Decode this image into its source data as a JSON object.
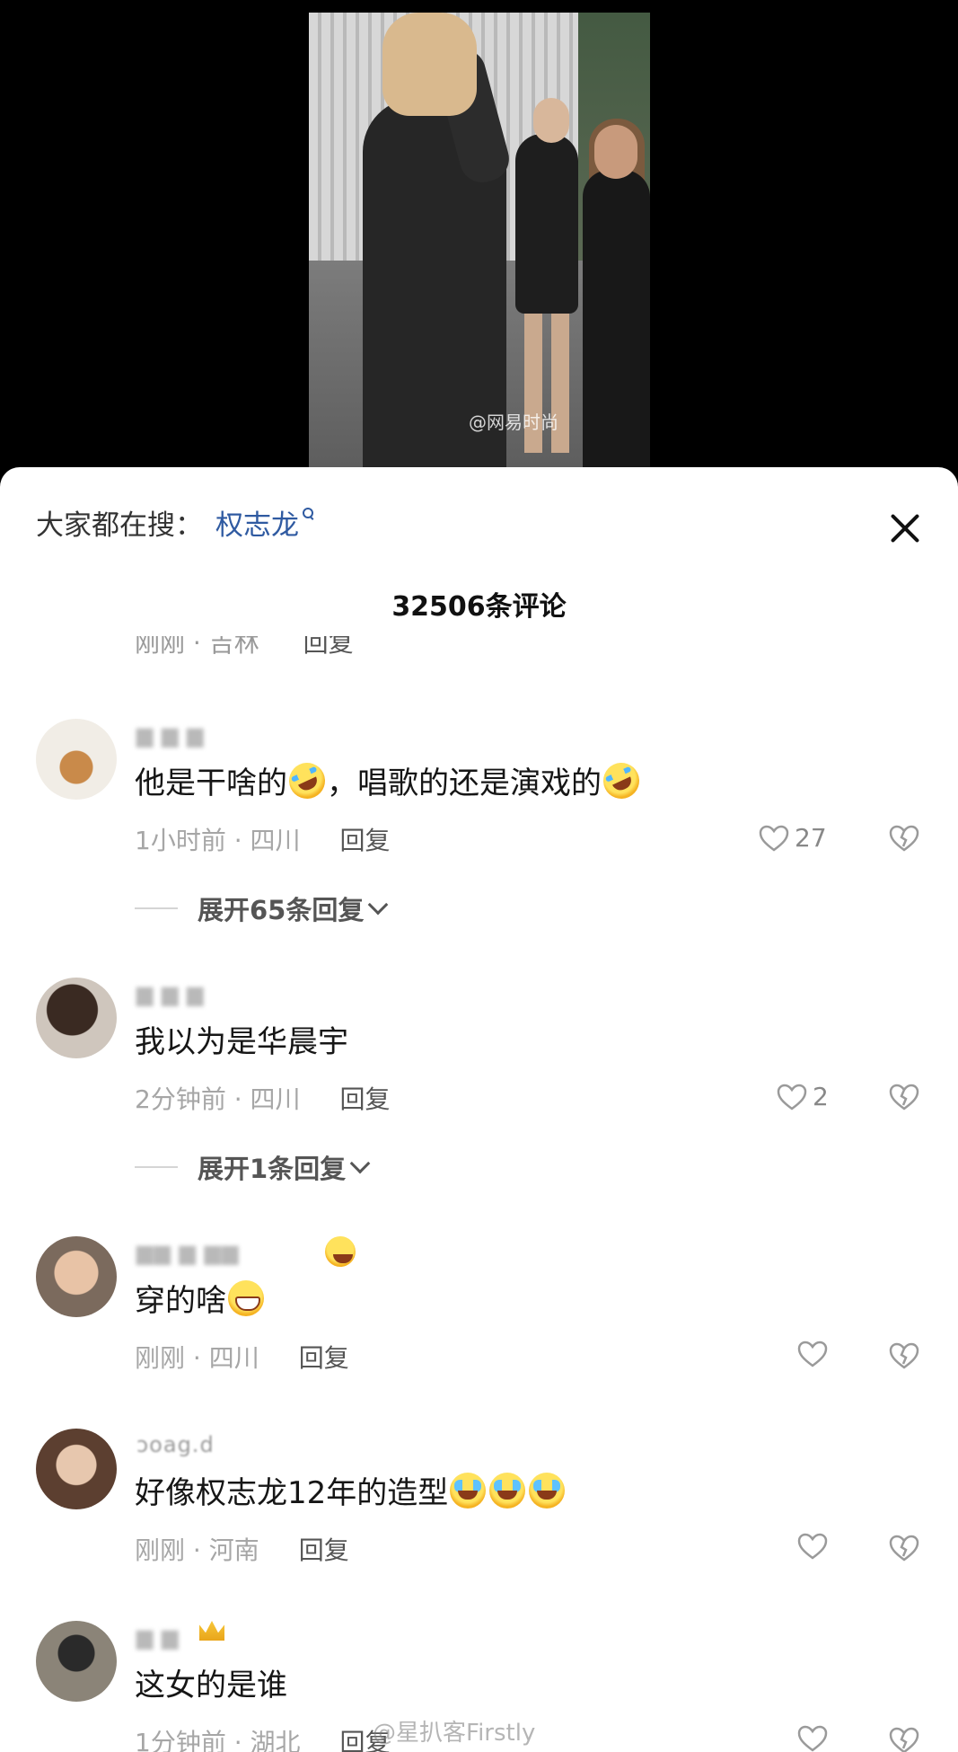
{
  "video": {
    "watermark": "@网易时尚"
  },
  "header": {
    "search_prefix": "大家都在搜：",
    "search_term": "权志龙",
    "comment_count": "32506条评论"
  },
  "cut_row": {
    "meta": "刚刚 · 吉林",
    "reply": "回复"
  },
  "comments": [
    {
      "username": "▆ ▆  ▆",
      "text_before": "他是干啥的",
      "text_middle": "，唱歌的还是演戏的",
      "meta": "1小时前 · 四川",
      "reply": "回复",
      "likes": "27",
      "expand": "展开65条回复"
    },
    {
      "username": "▆ ▆ ▆",
      "text": "我以为是华晨宇",
      "meta": "2分钟前 · 四川",
      "reply": "回复",
      "likes": "2",
      "expand": "展开1条回复"
    },
    {
      "username": "▆▆ ▆ ▆▆",
      "text": "穿的啥",
      "meta": "刚刚 · 四川",
      "reply": "回复"
    },
    {
      "username": "ɔoag.d",
      "text": "好像权志龙12年的造型",
      "meta": "刚刚 · 河南",
      "reply": "回复"
    },
    {
      "username": "▆ ▆",
      "text": "这女的是谁",
      "meta": "1分钟前 · 湖北",
      "reply": "回复"
    }
  ],
  "footer": {
    "watermark": "@星扒客Firstly"
  },
  "icons": {
    "like": "heart-outline-icon",
    "dislike": "broken-heart-icon",
    "close": "close-icon",
    "search": "search-icon",
    "expand": "chevron-down-icon"
  },
  "colors": {
    "link_blue": "#2f5aa1",
    "meta_gray": "#a6a6a6"
  }
}
